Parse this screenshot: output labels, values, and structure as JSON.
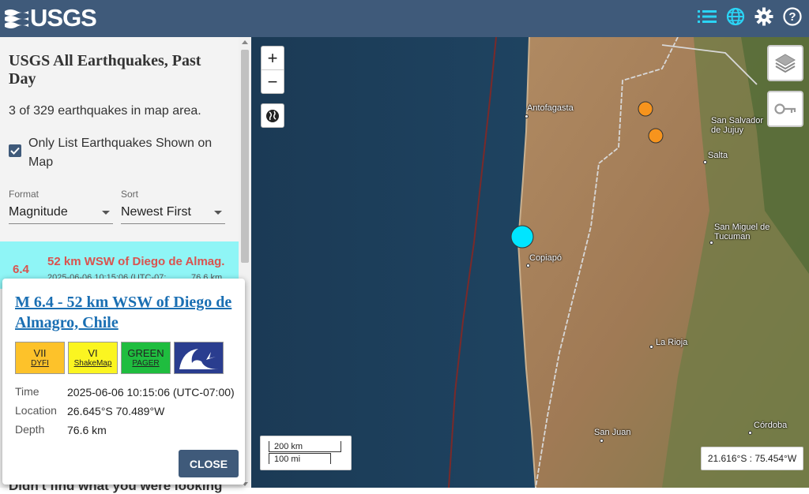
{
  "header": {
    "logo_text": "USGS"
  },
  "sidebar": {
    "title": "USGS All Earthquakes, Past Day",
    "count_text": "3 of 329 earthquakes in map area.",
    "only_list_label": "Only List Earthquakes Shown on Map",
    "only_list_checked": true,
    "format_label": "Format",
    "format_value": "Magnitude",
    "sort_label": "Sort",
    "sort_value": "Newest First",
    "selected_eq": {
      "mag": "6.4",
      "place": "52 km WSW of Diego de Almag...",
      "time": "2025-06-06 10:15:06 (UTC-07:",
      "depth": "76.6 km"
    },
    "didnt_find": "Didn't find what you were looking"
  },
  "popup": {
    "title": "M 6.4 - 52 km WSW of Diego de Almagro, Chile",
    "badges": [
      {
        "top": "VII",
        "bottom": "DYFI",
        "color": "#fdc22a"
      },
      {
        "top": "VI",
        "bottom": "ShakeMap",
        "color": "#fbf521"
      },
      {
        "top": "GREEN",
        "bottom": "PAGER",
        "color": "#1fbd3f"
      }
    ],
    "time_label": "Time",
    "time_value": "2025-06-06 10:15:06 (UTC-07:00)",
    "location_label": "Location",
    "location_value": "26.645°S 70.489°W",
    "depth_label": "Depth",
    "depth_value": "76.6 km",
    "close_label": "CLOSE"
  },
  "map": {
    "zoom_in": "+",
    "zoom_out": "−",
    "scale_km": "200 km",
    "scale_mi": "100 mi",
    "coords": "21.616°S : 75.454°W",
    "cities": {
      "antofagasta": "Antofagasta",
      "salvador": "San Salvador de Jujuy",
      "salta": "Salta",
      "tucuman": "San Miguel de Tucuman",
      "copiapo": "Copiapó",
      "rioja": "La Rioja",
      "sanjuan": "San Juan",
      "cordoba": "Córdoba"
    }
  },
  "colors": {
    "header": "#3f5a7a",
    "selected_row": "#8ff5f6",
    "mag_text": "#d9534f",
    "link": "#1a6fb3",
    "eq_selected": "#00e5ff",
    "eq_other": "#f7941d"
  },
  "icons": [
    "list-icon",
    "globe-icon",
    "gear-icon",
    "help-icon",
    "layers-icon",
    "key-icon"
  ]
}
